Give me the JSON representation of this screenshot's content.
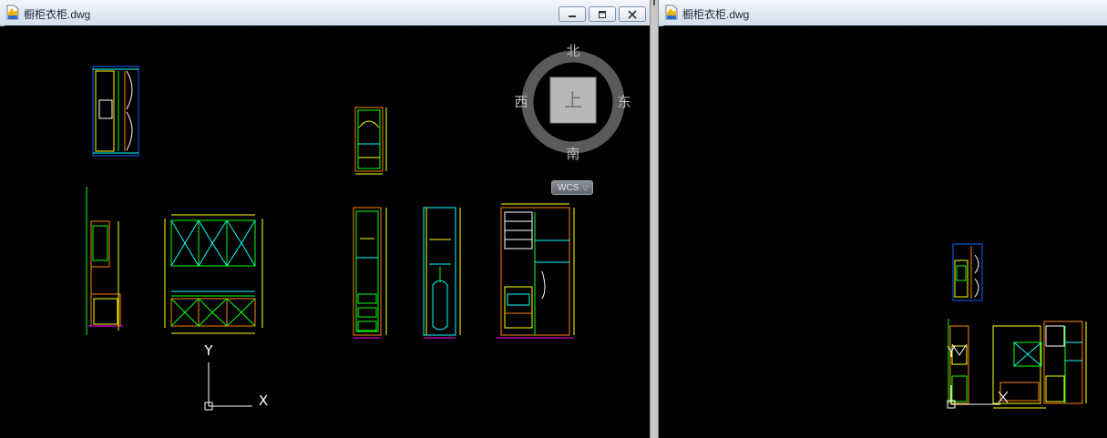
{
  "left_window": {
    "title": "橱柜衣柜.dwg",
    "controls": {
      "minimize": "minimize-icon",
      "restore": "restore-icon",
      "close": "close-icon"
    }
  },
  "right_window": {
    "title": "橱柜衣柜.dwg"
  },
  "viewcube": {
    "north": "北",
    "south": "南",
    "east": "东",
    "west": "西",
    "face": "上",
    "wcs_label": "WCS"
  },
  "ucs": {
    "y_label": "Y",
    "x_label": "X"
  },
  "colors": {
    "cad_background": "#000000",
    "orange": "#ff7f00",
    "green": "#00ff00",
    "yellow": "#ffff00",
    "cyan": "#00ffff",
    "blue": "#0066ff",
    "white": "#ffffff",
    "magenta": "#ff00ff"
  }
}
